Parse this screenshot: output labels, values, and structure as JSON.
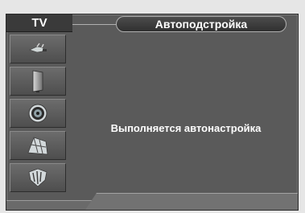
{
  "sidebar": {
    "title": "TV",
    "items": [
      {
        "icon": "antenna-icon"
      },
      {
        "icon": "picture-icon"
      },
      {
        "icon": "sound-icon"
      },
      {
        "icon": "channel-icon"
      },
      {
        "icon": "setup-icon"
      }
    ]
  },
  "header": {
    "title": "Автоподстройка"
  },
  "main": {
    "status": "Выполняется автонастройка"
  },
  "colors": {
    "frame": "#5a5a5a",
    "tile": "#6a6a6a",
    "text": "#ffffff",
    "pill": "#3c3c3c"
  }
}
